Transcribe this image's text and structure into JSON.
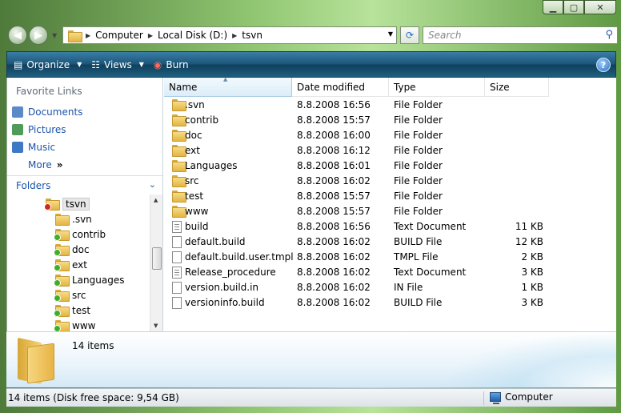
{
  "window": {
    "caption_minimize": "▁",
    "caption_maximize": "▢",
    "caption_close": "✕"
  },
  "address": {
    "crumbs": [
      "Computer",
      "Local Disk (D:)",
      "tsvn"
    ],
    "search_placeholder": "Search"
  },
  "toolbar": {
    "organize_label": "Organize",
    "views_label": "Views",
    "burn_label": "Burn",
    "help_label": "?"
  },
  "sidebar": {
    "favorite_links_title": "Favorite Links",
    "favorites": [
      {
        "label": "Documents",
        "icon": "documents-icon",
        "color": "#5a8bc8"
      },
      {
        "label": "Pictures",
        "icon": "pictures-icon",
        "color": "#4f9b5a"
      },
      {
        "label": "Music",
        "icon": "music-icon",
        "color": "#3f78c4"
      },
      {
        "label": "More",
        "icon": "more-chevron-icon",
        "color": "#ffffff"
      }
    ],
    "more_glyph": "»",
    "folders_title": "Folders",
    "tree": [
      {
        "label": "tsvn",
        "badge": "error",
        "selected": true
      },
      {
        "label": ".svn",
        "badge": "none"
      },
      {
        "label": "contrib",
        "badge": "ok"
      },
      {
        "label": "doc",
        "badge": "ok"
      },
      {
        "label": "ext",
        "badge": "ok"
      },
      {
        "label": "Languages",
        "badge": "ok"
      },
      {
        "label": "src",
        "badge": "ok"
      },
      {
        "label": "test",
        "badge": "ok"
      },
      {
        "label": "www",
        "badge": "ok"
      }
    ]
  },
  "file_list": {
    "columns": [
      "Name",
      "Date modified",
      "Type",
      "Size"
    ],
    "rows": [
      {
        "name": ".svn",
        "date": "8.8.2008 16:56",
        "type": "File Folder",
        "size": "",
        "icon": "folder"
      },
      {
        "name": "contrib",
        "date": "8.8.2008 15:57",
        "type": "File Folder",
        "size": "",
        "icon": "folder"
      },
      {
        "name": "doc",
        "date": "8.8.2008 16:00",
        "type": "File Folder",
        "size": "",
        "icon": "folder"
      },
      {
        "name": "ext",
        "date": "8.8.2008 16:12",
        "type": "File Folder",
        "size": "",
        "icon": "folder"
      },
      {
        "name": "Languages",
        "date": "8.8.2008 16:01",
        "type": "File Folder",
        "size": "",
        "icon": "folder"
      },
      {
        "name": "src",
        "date": "8.8.2008 16:02",
        "type": "File Folder",
        "size": "",
        "icon": "folder"
      },
      {
        "name": "test",
        "date": "8.8.2008 15:57",
        "type": "File Folder",
        "size": "",
        "icon": "folder"
      },
      {
        "name": "www",
        "date": "8.8.2008 15:57",
        "type": "File Folder",
        "size": "",
        "icon": "folder"
      },
      {
        "name": "build",
        "date": "8.8.2008 16:56",
        "type": "Text Document",
        "size": "11 KB",
        "icon": "text-doc"
      },
      {
        "name": "default.build",
        "date": "8.8.2008 16:02",
        "type": "BUILD File",
        "size": "12 KB",
        "icon": "doc"
      },
      {
        "name": "default.build.user.tmpl",
        "date": "8.8.2008 16:02",
        "type": "TMPL File",
        "size": "2 KB",
        "icon": "doc"
      },
      {
        "name": "Release_procedure",
        "date": "8.8.2008 16:02",
        "type": "Text Document",
        "size": "3 KB",
        "icon": "text-doc"
      },
      {
        "name": "version.build.in",
        "date": "8.8.2008 16:02",
        "type": "IN File",
        "size": "1 KB",
        "icon": "doc"
      },
      {
        "name": "versioninfo.build",
        "date": "8.8.2008 16:02",
        "type": "BUILD File",
        "size": "3 KB",
        "icon": "doc"
      }
    ]
  },
  "details": {
    "item_count": "14 items"
  },
  "status": {
    "left_text": "14 items (Disk free space: 9,54 GB)",
    "right_text": "Computer"
  }
}
